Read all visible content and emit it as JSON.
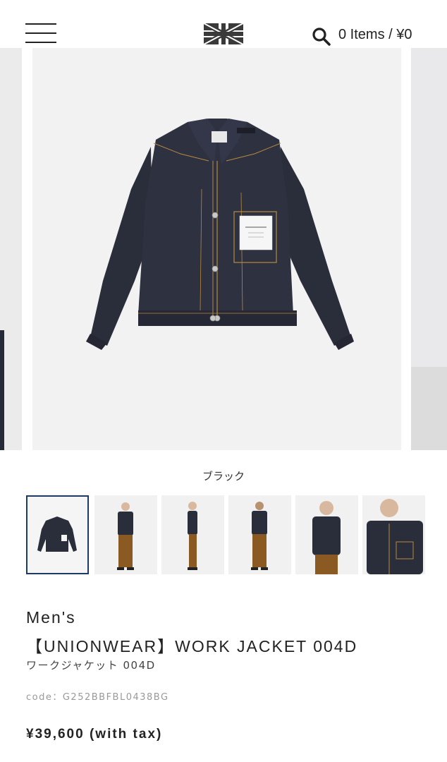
{
  "header": {
    "cart_text": "0 Items / ¥0"
  },
  "product": {
    "color_label": "ブラック",
    "category": "Men's",
    "name": "【UNIONWEAR】WORK JACKET 004D",
    "name_jp": "ワークジャケット 004D",
    "code": "code：G252BBFBL0438BG",
    "price": "¥39,600 (with tax)"
  },
  "label_tag": "UNIONWEAR",
  "icons": [
    "menu-icon",
    "union-jack-logo",
    "search-icon"
  ],
  "colors": {
    "denim": "#2a2d3a",
    "stitch": "#b8893f",
    "selected_border": "#1d3a63",
    "brown_trousers": "#8a5a22"
  }
}
